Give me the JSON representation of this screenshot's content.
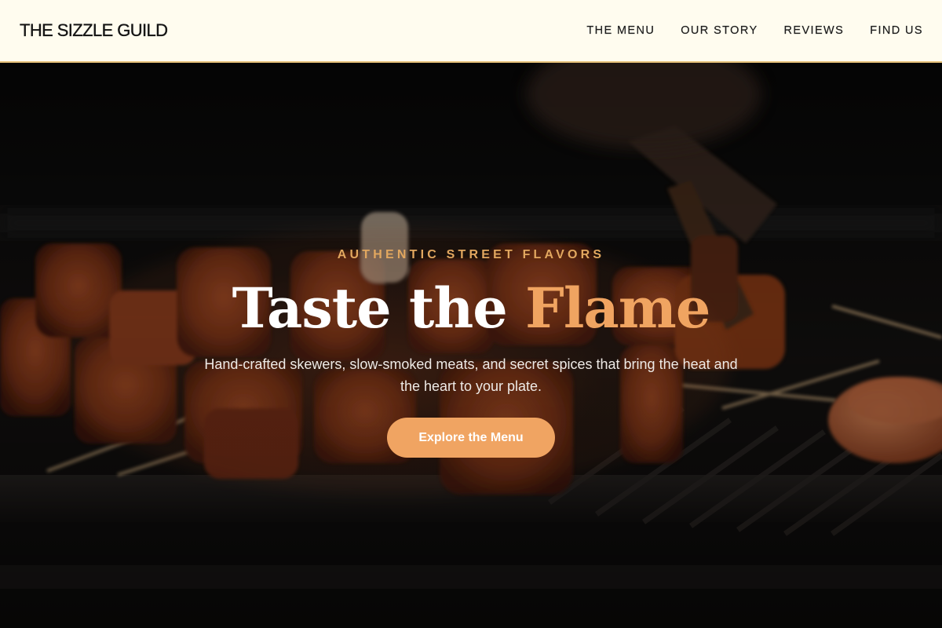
{
  "header": {
    "brand": "THE SIZZLE GUILD",
    "nav": [
      {
        "label": "THE MENU"
      },
      {
        "label": "OUR STORY"
      },
      {
        "label": "REVIEWS"
      },
      {
        "label": "FIND US"
      }
    ]
  },
  "hero": {
    "eyebrow": "AUTHENTIC STREET FLAVORS",
    "headline_lead": "Taste the",
    "headline_accent": "Flame",
    "subtitle": "Hand-crafted skewers, slow-smoked meats, and secret spices that bring the heat and the heart to your plate.",
    "cta_label": "Explore the Menu",
    "background_image": "grilled-skewers-photo"
  },
  "colors": {
    "header_bg": "#fffcef",
    "header_border": "#e7c27a",
    "accent": "#f0a461",
    "eyebrow": "#e2a75f",
    "cta_bg": "#f0a462"
  }
}
